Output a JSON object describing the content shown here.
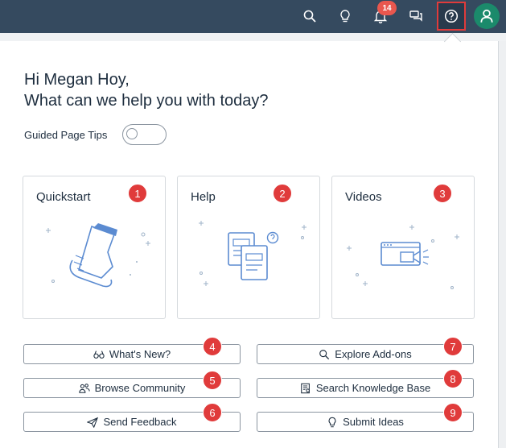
{
  "shell": {
    "notification_count": "14",
    "icons": [
      "search-icon",
      "lightbulb-icon",
      "bell-icon",
      "chat-icon",
      "help-icon",
      "user-icon"
    ]
  },
  "help_panel": {
    "greeting_line1": "Hi Megan Hoy,",
    "greeting_line2": "What can we help you with today?",
    "guided_tips_label": "Guided Page Tips",
    "guided_tips_on": false,
    "cards": [
      {
        "title": "Quickstart",
        "badge": "1"
      },
      {
        "title": "Help",
        "badge": "2"
      },
      {
        "title": "Videos",
        "badge": "3"
      }
    ],
    "links": [
      {
        "label": "What's New?",
        "badge": "4",
        "icon": "glasses-icon"
      },
      {
        "label": "Browse Community",
        "badge": "5",
        "icon": "people-icon"
      },
      {
        "label": "Send Feedback",
        "badge": "6",
        "icon": "paper-plane-icon"
      },
      {
        "label": "Explore Add-ons",
        "badge": "7",
        "icon": "search-icon"
      },
      {
        "label": "Search Knowledge Base",
        "badge": "8",
        "icon": "knowledge-base-icon"
      },
      {
        "label": "Submit Ideas",
        "badge": "9",
        "icon": "lightbulb-icon"
      }
    ]
  },
  "colors": {
    "shell_bar": "#354a5f",
    "accent_red": "#e03b3b",
    "avatar_green": "#1b8a6b",
    "illustration_blue": "#5b8bd1"
  }
}
